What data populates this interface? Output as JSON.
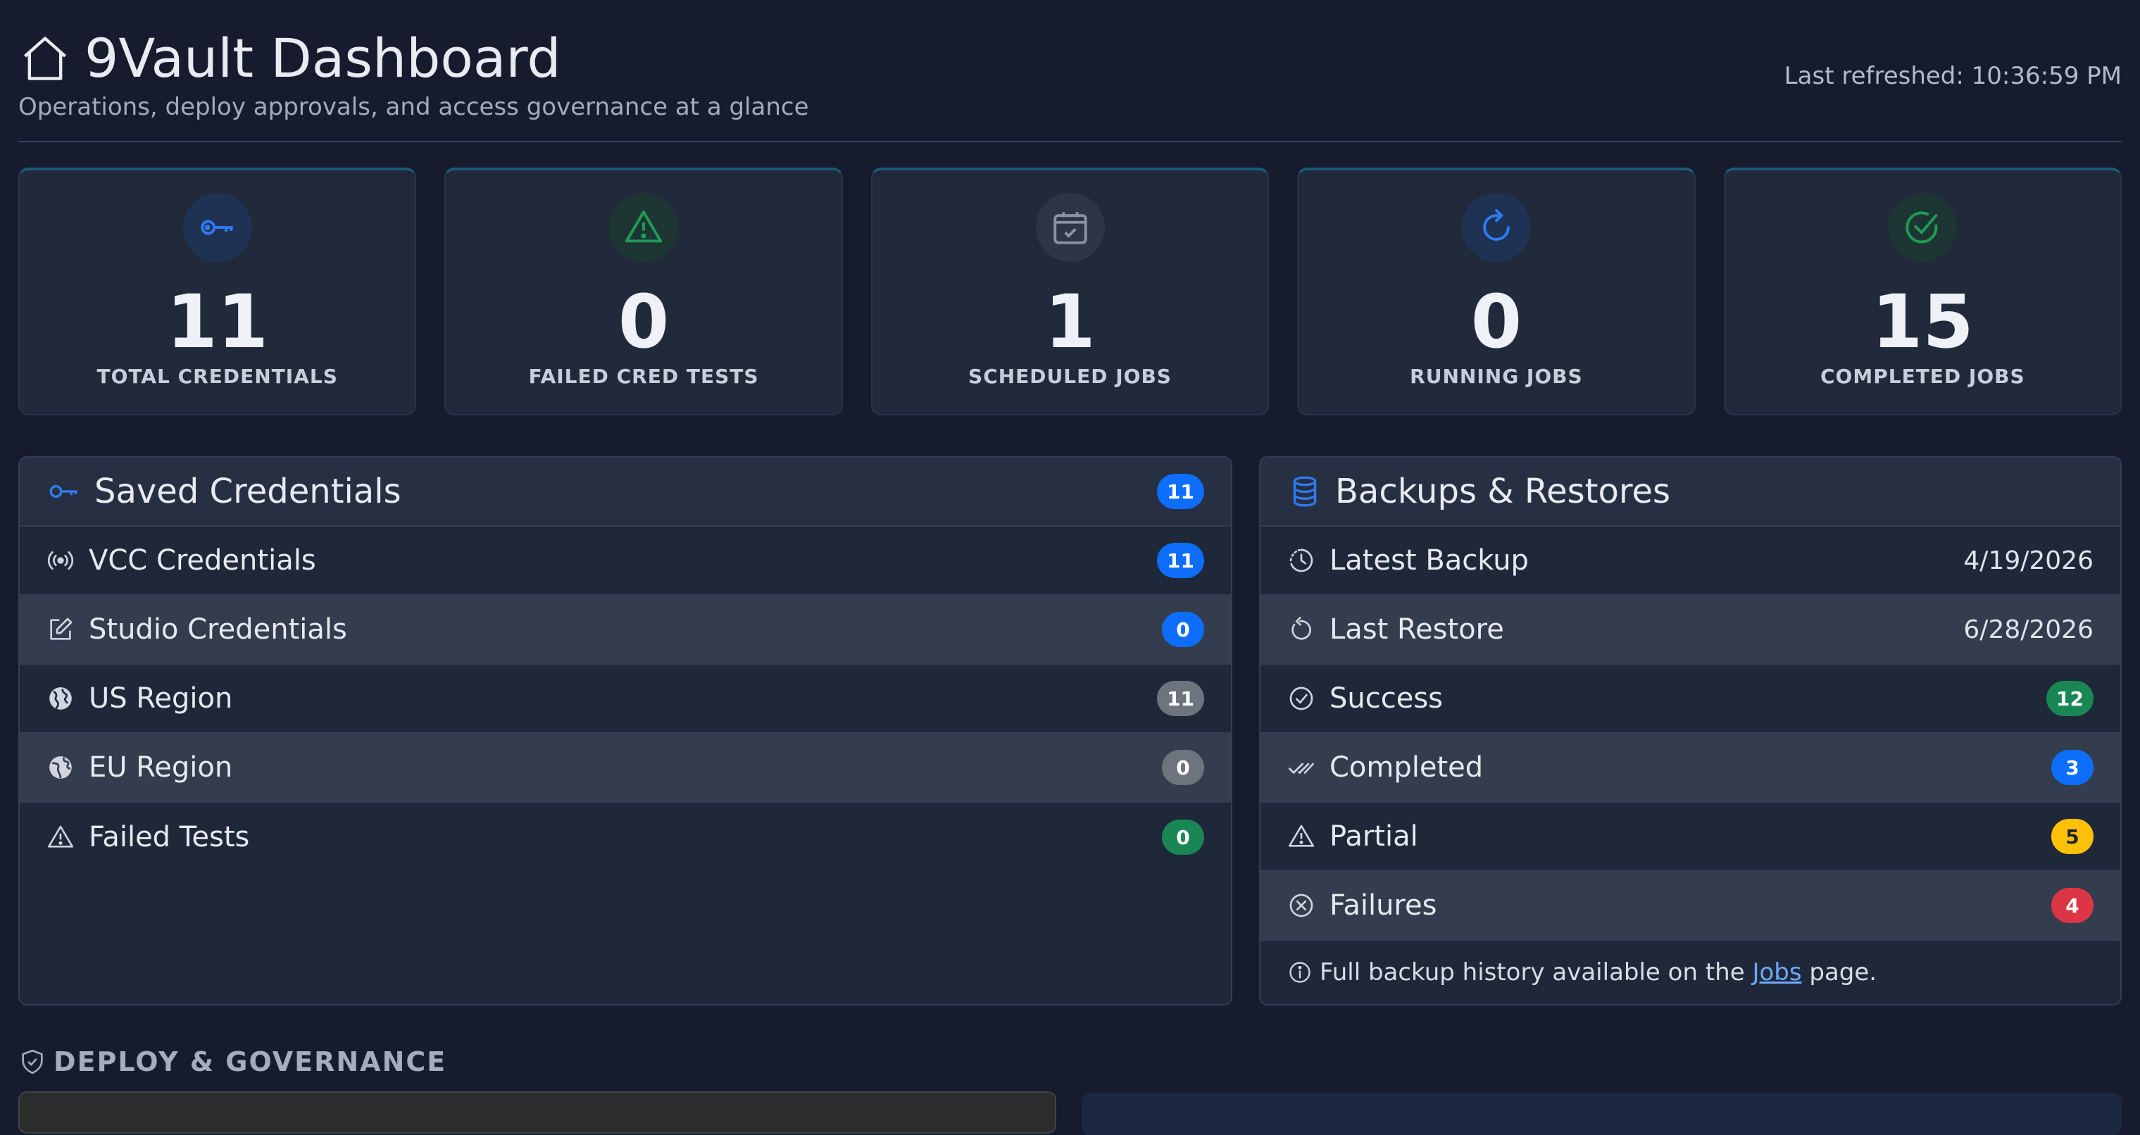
{
  "header": {
    "title": "9Vault Dashboard",
    "subtitle": "Operations, deploy approvals, and access governance at a glance",
    "last_refreshed": "Last refreshed: 10:36:59 PM"
  },
  "stats": [
    {
      "value": "11",
      "label": "TOTAL CREDENTIALS",
      "icon": "key-icon",
      "color": "#2f7bf5"
    },
    {
      "value": "0",
      "label": "FAILED CRED TESTS",
      "icon": "warning-icon",
      "color": "#1f9d55"
    },
    {
      "value": "1",
      "label": "SCHEDULED JOBS",
      "icon": "calendar-check-icon",
      "color": "#8a93a3"
    },
    {
      "value": "0",
      "label": "RUNNING JOBS",
      "icon": "refresh-icon",
      "color": "#2f7bf5"
    },
    {
      "value": "15",
      "label": "COMPLETED JOBS",
      "icon": "check-circle-icon",
      "color": "#1f9d55"
    }
  ],
  "credentials_panel": {
    "title": "Saved Credentials",
    "count": "11",
    "rows": [
      {
        "label": "VCC Credentials",
        "count": "11",
        "icon": "broadcast-icon"
      },
      {
        "label": "Studio Credentials",
        "count": "0",
        "icon": "edit-icon"
      },
      {
        "label": "US Region",
        "count": "11",
        "icon": "globe-americas-icon"
      },
      {
        "label": "EU Region",
        "count": "0",
        "icon": "globe-europe-icon"
      },
      {
        "label": "Failed Tests",
        "count": "0",
        "icon": "warning-icon"
      }
    ]
  },
  "backups_panel": {
    "title": "Backups & Restores",
    "rows": [
      {
        "label": "Latest Backup",
        "value": "4/19/2026",
        "icon": "clock-history-icon"
      },
      {
        "label": "Last Restore",
        "value": "6/28/2026",
        "icon": "restore-icon"
      },
      {
        "label": "Success",
        "count": "12",
        "icon": "check-circle-icon"
      },
      {
        "label": "Completed",
        "count": "3",
        "icon": "double-check-icon"
      },
      {
        "label": "Partial",
        "count": "5",
        "icon": "warning-icon"
      },
      {
        "label": "Failures",
        "count": "4",
        "icon": "x-circle-icon"
      }
    ],
    "footer_prefix": "Full backup history available on the",
    "footer_link": "Jobs",
    "footer_suffix": "page."
  },
  "deploy_section": {
    "title": "DEPLOY & GOVERNANCE"
  },
  "colors": {
    "background": "#161c2e",
    "card": "#202a3b",
    "accent_blue": "#0d6efd",
    "success": "#198754",
    "warning": "#ffc107",
    "danger": "#dc3545",
    "muted": "#6c757d"
  }
}
